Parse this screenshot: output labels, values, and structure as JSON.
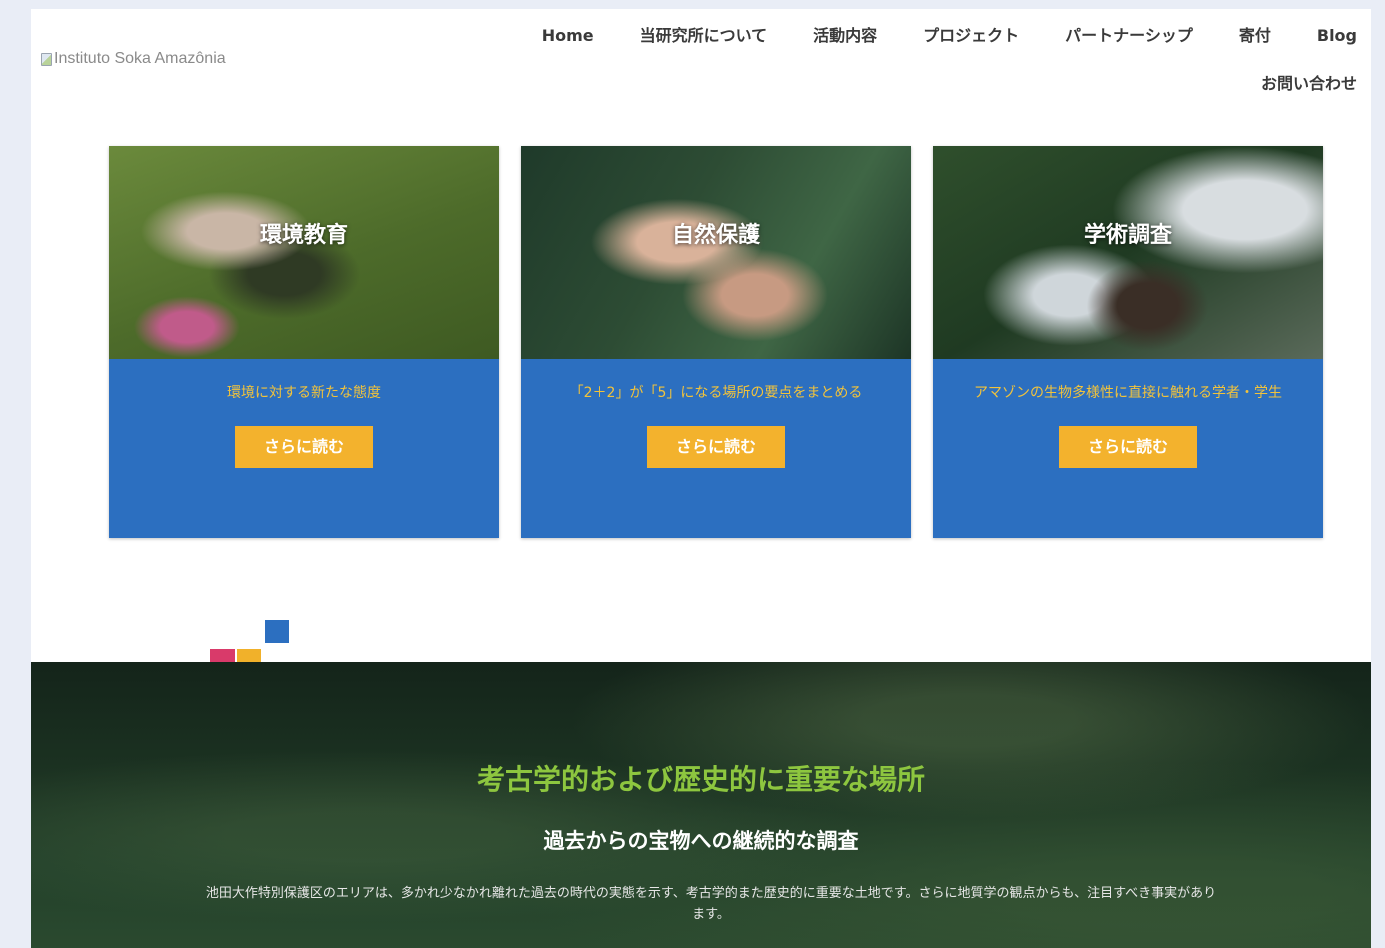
{
  "header": {
    "logo_alt": "Instituto Soka Amazônia",
    "nav": [
      "Home",
      "当研究所について",
      "活動内容",
      "プロジェクト",
      "パートナーシップ",
      "寄付",
      "Blog"
    ],
    "nav_row2": [
      "お問い合わせ"
    ]
  },
  "cards": [
    {
      "title": "環境教育",
      "desc": "環境に対する新たな態度",
      "button": "さらに読む",
      "image": "children-planting-photo"
    },
    {
      "title": "自然保護",
      "desc": "「2＋2」が「5」になる場所の要点をまとめる",
      "button": "さらに読む",
      "image": "cupped-hands-photo"
    },
    {
      "title": "学術調査",
      "desc": "アマゾンの生物多様性に直接に触れる学者・学生",
      "button": "さらに読む",
      "image": "seedling-in-gloves-photo"
    }
  ],
  "forest": {
    "title": "考古学的および歴史的に重要な場所",
    "subtitle": "過去からの宝物への継続的な調査",
    "text": "池田大作特別保護区のエリアは、多かれ少なかれ離れた過去の時代の実態を示す、考古学的また歴史的に重要な土地です。さらに地質学の観点からも、注目すべき事実があります。"
  },
  "colors": {
    "card_blue": "#2c6fc0",
    "button_yellow": "#f3b22d",
    "accent_green": "#8dc63f",
    "pink": "#d93a6a"
  }
}
